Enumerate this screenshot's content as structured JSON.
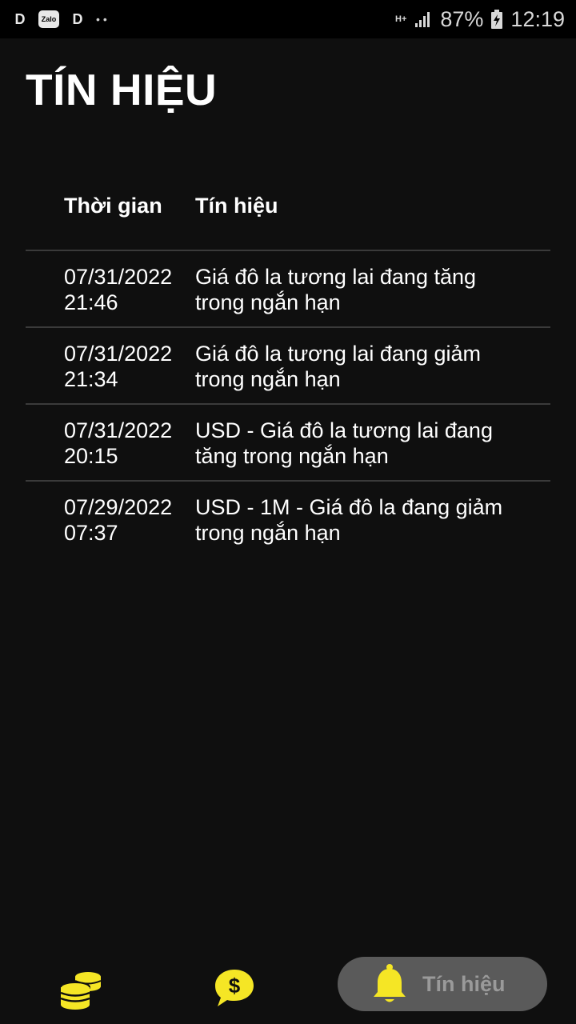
{
  "statusbar": {
    "zalo": "Zalo",
    "dots": "••",
    "network": "H+",
    "battery": "87%",
    "time": "12:19"
  },
  "page": {
    "title": "TÍN HIỆU"
  },
  "table": {
    "headers": {
      "time": "Thời gian",
      "signal": "Tín hiệu"
    },
    "rows": [
      {
        "time": "07/31/2022\n21:46",
        "signal": "Giá đô la  tương lai đang tăng trong ngắn hạn"
      },
      {
        "time": "07/31/2022\n21:34",
        "signal": "Giá đô la tương lai đang giảm trong ngắn hạn"
      },
      {
        "time": "07/31/2022\n20:15",
        "signal": "USD - Giá đô la  tương lai đang tăng trong ngắn hạn"
      },
      {
        "time": "07/29/2022\n07:37",
        "signal": "USD - 1M - Giá đô la đang giảm trong ngắn hạn"
      }
    ]
  },
  "bottom_nav": {
    "active_label": "Tín hiệu",
    "accent_color": "#f5e625",
    "icons": [
      "coins-icon",
      "dollar-chat-icon",
      "bell-icon"
    ]
  }
}
